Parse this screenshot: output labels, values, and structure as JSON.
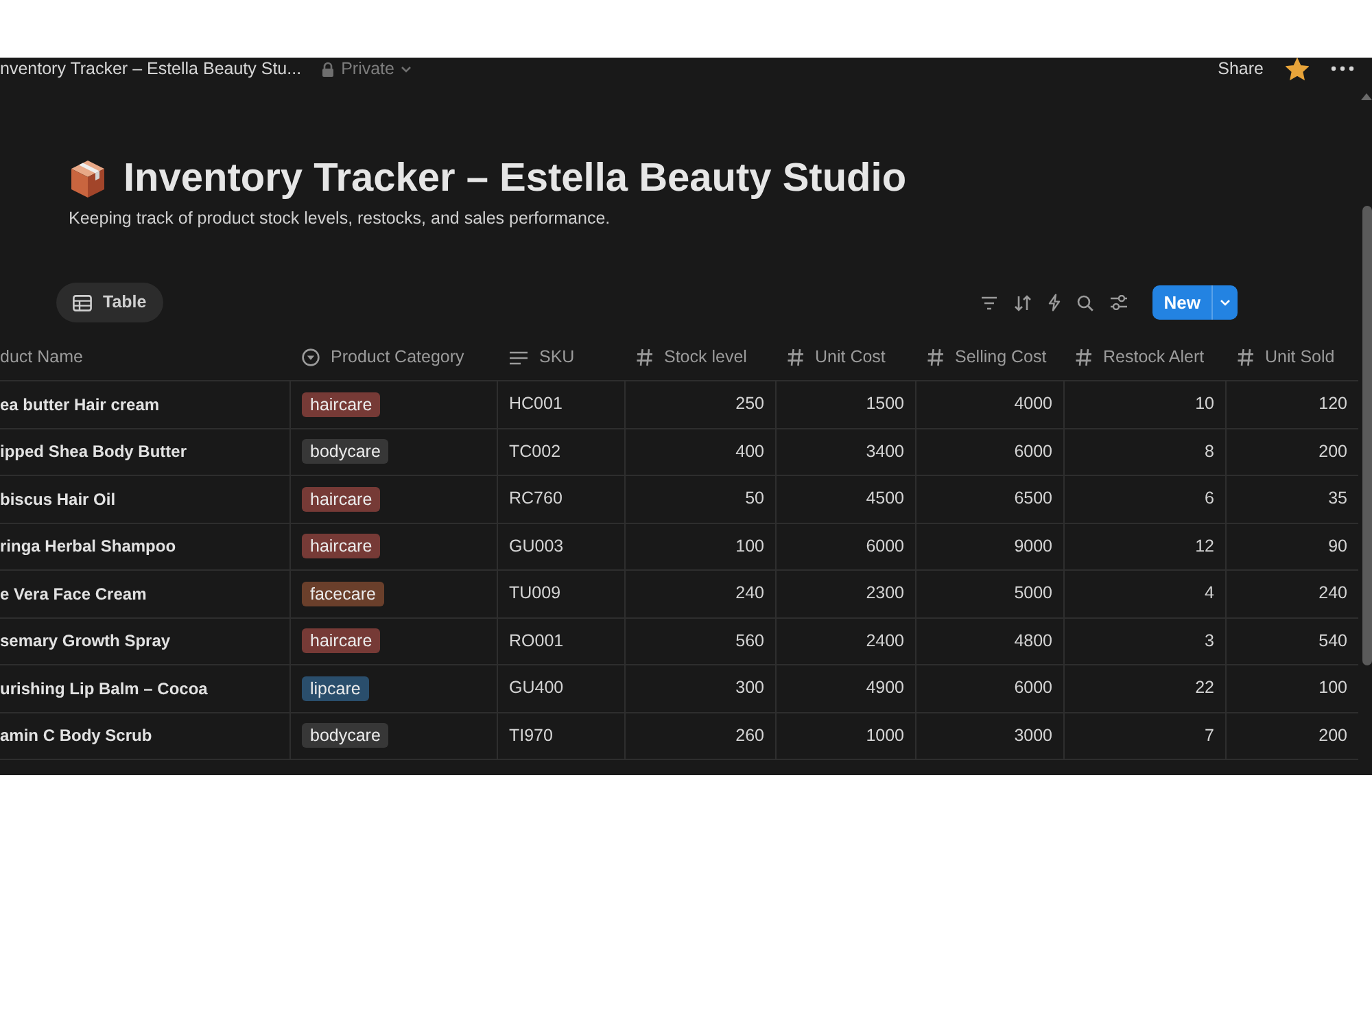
{
  "topbar": {
    "page_title": "nventory Tracker – Estella Beauty Stu...",
    "privacy": "Private",
    "share": "Share",
    "favorited": true
  },
  "page": {
    "title": "Inventory Tracker – Estella Beauty Studio",
    "description": "Keeping track of product stock levels, restocks, and sales performance."
  },
  "views": [
    {
      "label": "Table",
      "selected": true
    }
  ],
  "toolbar": {
    "new_button": "New"
  },
  "table": {
    "columns": [
      {
        "label": "duct Name",
        "kind": "title"
      },
      {
        "label": "Product Category",
        "kind": "select"
      },
      {
        "label": "SKU",
        "kind": "text"
      },
      {
        "label": "Stock level",
        "kind": "number"
      },
      {
        "label": "Unit Cost",
        "kind": "number"
      },
      {
        "label": "Selling Cost",
        "kind": "number"
      },
      {
        "label": "Restock Alert",
        "kind": "number"
      },
      {
        "label": "Unit Sold",
        "kind": "number"
      }
    ],
    "rows": [
      {
        "name": "ea butter Hair cream",
        "category": {
          "label": "haircare",
          "color": "#763a36"
        },
        "sku": "HC001",
        "numbers": [
          "250",
          "1500",
          "4000",
          "10",
          "120"
        ]
      },
      {
        "name": "ipped Shea Body Butter",
        "category": {
          "label": "bodycare",
          "color": "#373737"
        },
        "sku": "TC002",
        "numbers": [
          "400",
          "3400",
          "6000",
          "8",
          "200"
        ]
      },
      {
        "name": "biscus Hair Oil",
        "category": {
          "label": "haircare",
          "color": "#763a36"
        },
        "sku": "RC760",
        "numbers": [
          "50",
          "4500",
          "6500",
          "6",
          "35"
        ]
      },
      {
        "name": "ringa Herbal Shampoo",
        "category": {
          "label": "haircare",
          "color": "#763a36"
        },
        "sku": "GU003",
        "numbers": [
          "100",
          "6000",
          "9000",
          "12",
          "90"
        ]
      },
      {
        "name": "e Vera Face Cream",
        "category": {
          "label": "facecare",
          "color": "#6a3f2b"
        },
        "sku": "TU009",
        "numbers": [
          "240",
          "2300",
          "5000",
          "4",
          "240"
        ]
      },
      {
        "name": "semary Growth Spray",
        "category": {
          "label": "haircare",
          "color": "#763a36"
        },
        "sku": "RO001",
        "numbers": [
          "560",
          "2400",
          "4800",
          "3",
          "540"
        ]
      },
      {
        "name": "urishing Lip Balm – Cocoa",
        "category": {
          "label": "lipcare",
          "color": "#2a4e6c"
        },
        "sku": "GU400",
        "numbers": [
          "300",
          "4900",
          "6000",
          "22",
          "100"
        ]
      },
      {
        "name": "amin C Body Scrub",
        "category": {
          "label": "bodycare",
          "color": "#373737"
        },
        "sku": "TI970",
        "numbers": [
          "260",
          "1000",
          "3000",
          "7",
          "200"
        ]
      }
    ]
  }
}
